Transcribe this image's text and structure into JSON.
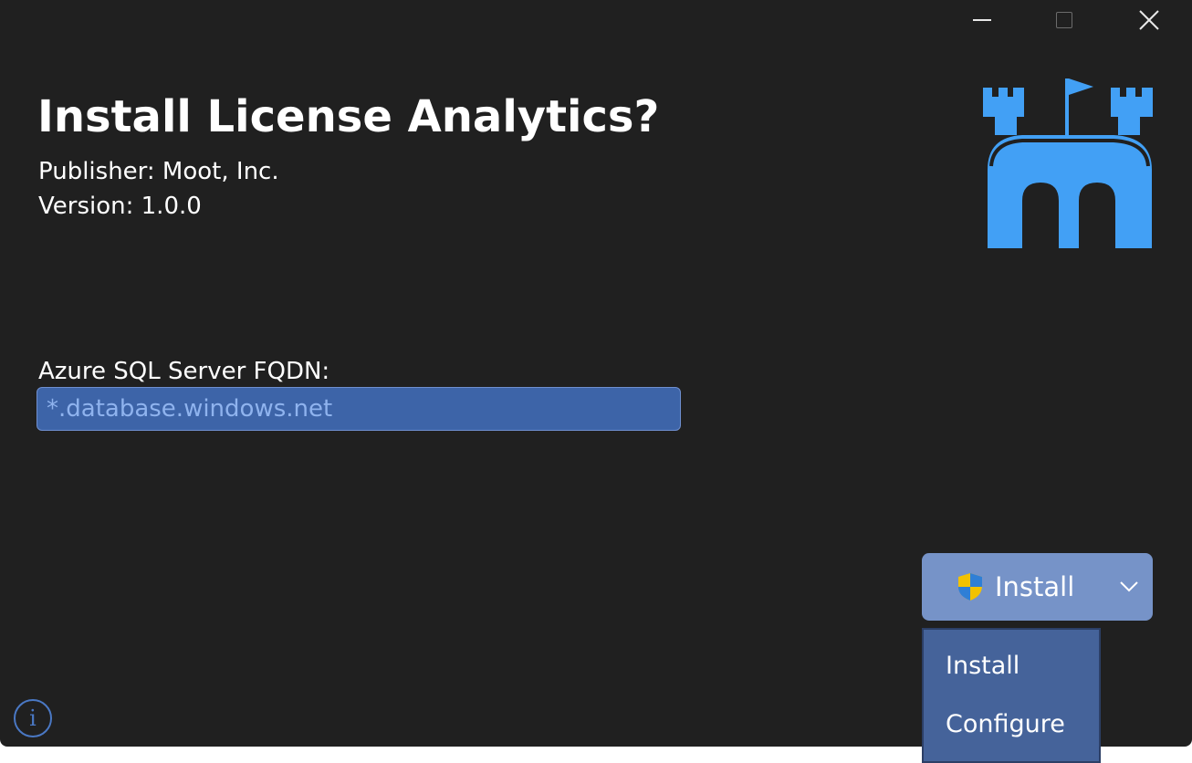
{
  "window": {
    "caption": {
      "minimize_icon": "minimize-icon",
      "maximize_icon": "maximize-icon",
      "close_icon": "close-icon"
    }
  },
  "header": {
    "title": "Install License Analytics?",
    "publisher": "Publisher: Moot, Inc.",
    "version": "Version: 1.0.0"
  },
  "logo": {
    "icon": "castle-icon",
    "color": "#42a0f5"
  },
  "form": {
    "fqdn_label": "Azure SQL Server FQDN:",
    "fqdn_placeholder": "*.database.windows.net",
    "fqdn_value": ""
  },
  "action_button": {
    "label": "Install",
    "icon": "uac-shield-icon",
    "dropdown_icon": "chevron-down-icon"
  },
  "action_menu": {
    "items": [
      "Install",
      "Configure"
    ]
  },
  "footer": {
    "info_icon": "info-icon",
    "info_glyph": "i"
  },
  "colors": {
    "background": "#202020",
    "accent": "#42a0f5",
    "input_bg": "#3d64a8",
    "button_bg": "#7693c8",
    "menu_bg": "#45639a"
  }
}
